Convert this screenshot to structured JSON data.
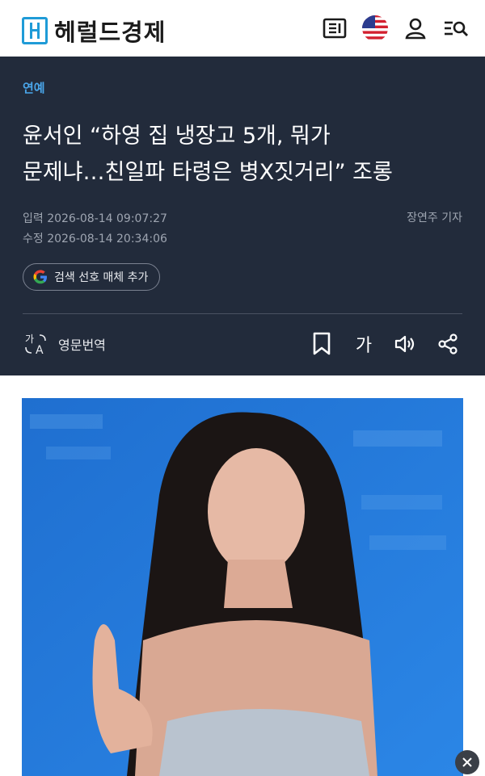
{
  "header": {
    "logo_text": "헤럴드경제",
    "icons": [
      "newspaper-icon",
      "us-flag-icon",
      "user-icon",
      "search-menu-icon"
    ],
    "brand_color": "#1f9bd7"
  },
  "article": {
    "category": "연예",
    "title_line1": "윤서인 “하영 집 냉장고 5개, 뭐가",
    "title_line2": "문제냐…친일파 타령은 병X짓거리” 조롱",
    "published": "입력 2026-08-14 09:07:27",
    "modified": "수정 2026-08-14 20:34:06",
    "reporter": "장연주 기자",
    "preferred_source_label": "검색 선호 매체 추가",
    "translate_label": "영문번역",
    "font_size_label": "가",
    "theme_colors": {
      "header_bg": "#222b3b",
      "category": "#4aa6ea"
    }
  },
  "photo": {
    "alt": "",
    "close_icon": "close-icon"
  }
}
